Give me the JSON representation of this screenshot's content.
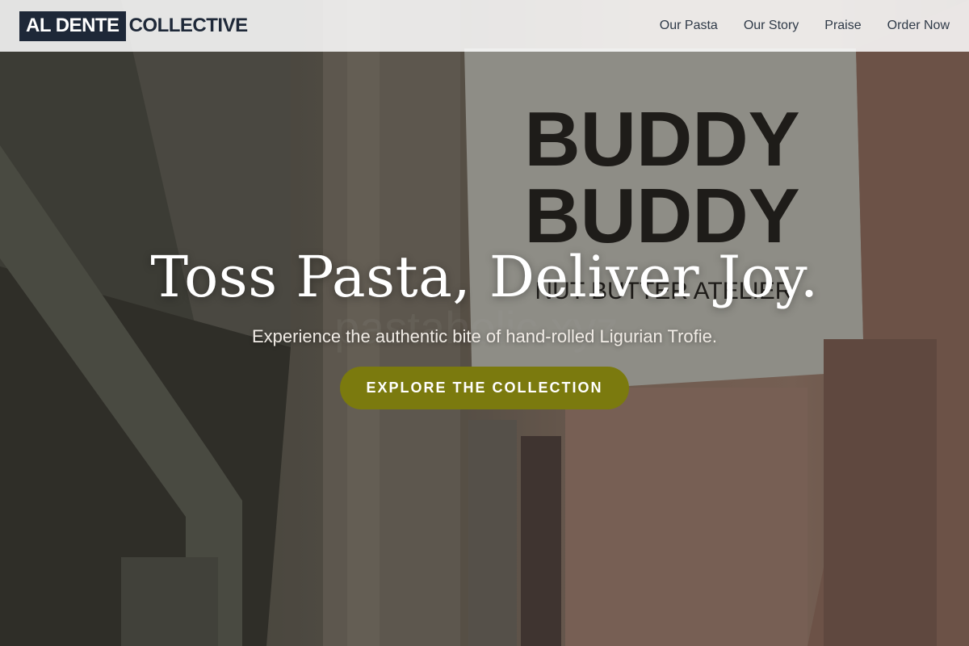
{
  "brand": {
    "boxed": "AL DENTE",
    "rest": "COLLECTIVE"
  },
  "nav": {
    "items": [
      {
        "label": "Our Pasta"
      },
      {
        "label": "Our Story"
      },
      {
        "label": "Praise"
      },
      {
        "label": "Order Now"
      }
    ]
  },
  "hero": {
    "title": "Toss Pasta, Deliver Joy.",
    "subtitle": "Experience the authentic bite of hand-rolled Ligurian Trofie.",
    "cta_label": "EXPLORE THE COLLECTION",
    "background": {
      "sign_text_line1": "BUDDY",
      "sign_text_line2": "BUDDY",
      "sign_text_line3": "NUT BUTTER ATELIER",
      "watermark": "pastaholic.xyz"
    }
  },
  "colors": {
    "brand_dark": "#1e2838",
    "cta": "#7b7a0e",
    "nav_bg": "rgba(255,255,255,0.86)"
  }
}
